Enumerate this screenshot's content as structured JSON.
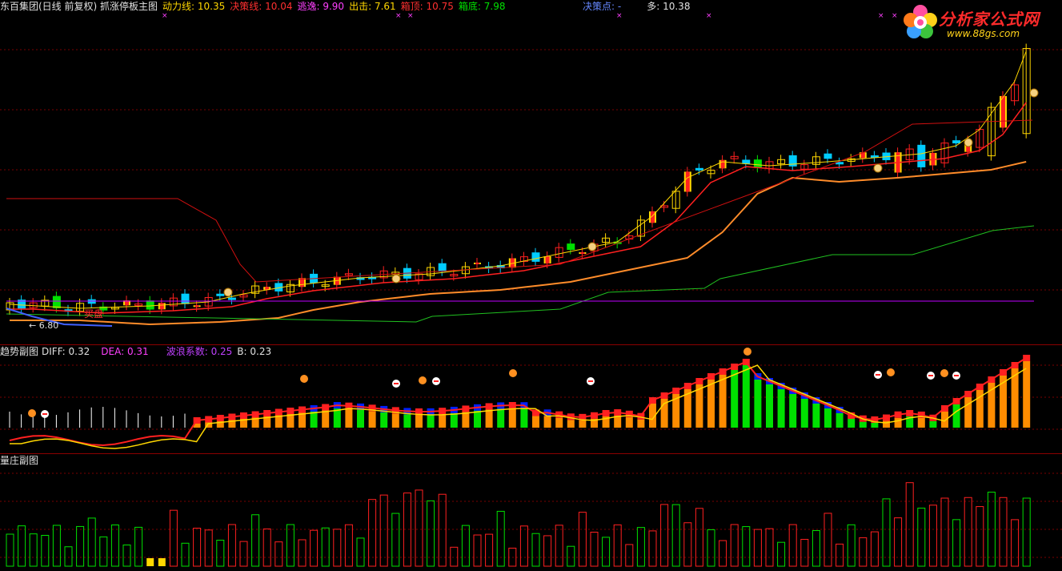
{
  "main_header": {
    "stock": "东百集团(日线 前复权) 抓涨停板主图",
    "dongli_label": "动力线:",
    "dongli_value": "10.35",
    "juece_label": "决策线:",
    "juece_value": "10.04",
    "taoyi_label": "逃逸:",
    "taoyi_value": "9.90",
    "chuji_label": "出击:",
    "chuji_value": "7.61",
    "xiangding_label": "箱顶:",
    "xiangding_value": "10.75",
    "xiangdi_label": "箱底:",
    "xiangdi_value": "7.98",
    "juecedian_label": "决策点:",
    "juecedian_value": "-",
    "duo_label": "多:",
    "duo_value": "10.38"
  },
  "main_chart": {
    "low_label": "6.80",
    "buy_label": "买盘"
  },
  "trend_header": {
    "title": "趋势副图",
    "diff_label": "DIFF:",
    "diff_value": "0.32",
    "dea_label": "DEA:",
    "dea_value": "0.31",
    "wave_label": "波浪系数:",
    "wave_value": "0.25",
    "b_label": "B:",
    "b_value": "0.23"
  },
  "volume_header": {
    "title": "量庄副图"
  },
  "logo": {
    "name": "分析家公式网",
    "url": "www.88gs.com"
  },
  "colors": {
    "up": "#ff2020",
    "down": "#00ccff",
    "yellow": "#ffd700",
    "green": "#00e000",
    "orange": "#ff8c00",
    "purple": "#c000ff",
    "dark_red": "#8b0000"
  }
}
